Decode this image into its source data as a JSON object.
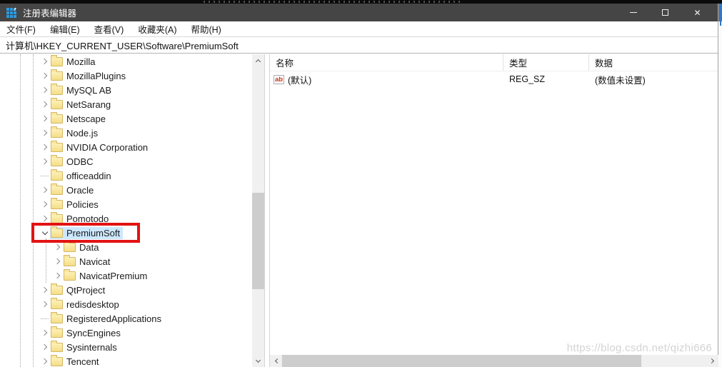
{
  "window": {
    "title": "注册表编辑器"
  },
  "icons": {
    "close": "✕",
    "app": "registry-grid-icon",
    "reg_sz_badge": "ab"
  },
  "menu": {
    "items": [
      "文件(F)",
      "编辑(E)",
      "查看(V)",
      "收藏夹(A)",
      "帮助(H)"
    ]
  },
  "address": {
    "value": "计算机\\HKEY_CURRENT_USER\\Software\\PremiumSoft"
  },
  "tree": {
    "items": [
      {
        "label": "Mozilla",
        "depth": 0,
        "chevron": "collapsed",
        "selected": false,
        "annotated": false
      },
      {
        "label": "MozillaPlugins",
        "depth": 0,
        "chevron": "collapsed",
        "selected": false,
        "annotated": false
      },
      {
        "label": "MySQL AB",
        "depth": 0,
        "chevron": "collapsed",
        "selected": false,
        "annotated": false
      },
      {
        "label": "NetSarang",
        "depth": 0,
        "chevron": "collapsed",
        "selected": false,
        "annotated": false
      },
      {
        "label": "Netscape",
        "depth": 0,
        "chevron": "collapsed",
        "selected": false,
        "annotated": false
      },
      {
        "label": "Node.js",
        "depth": 0,
        "chevron": "collapsed",
        "selected": false,
        "annotated": false
      },
      {
        "label": "NVIDIA Corporation",
        "depth": 0,
        "chevron": "collapsed",
        "selected": false,
        "annotated": false
      },
      {
        "label": "ODBC",
        "depth": 0,
        "chevron": "collapsed",
        "selected": false,
        "annotated": false
      },
      {
        "label": "officeaddin",
        "depth": 0,
        "chevron": "none",
        "selected": false,
        "annotated": false
      },
      {
        "label": "Oracle",
        "depth": 0,
        "chevron": "collapsed",
        "selected": false,
        "annotated": false
      },
      {
        "label": "Policies",
        "depth": 0,
        "chevron": "collapsed",
        "selected": false,
        "annotated": false
      },
      {
        "label": "Pomotodo",
        "depth": 0,
        "chevron": "collapsed",
        "selected": false,
        "annotated": false
      },
      {
        "label": "PremiumSoft",
        "depth": 0,
        "chevron": "expanded",
        "selected": true,
        "annotated": true
      },
      {
        "label": "Data",
        "depth": 1,
        "chevron": "collapsed",
        "selected": false,
        "annotated": false
      },
      {
        "label": "Navicat",
        "depth": 1,
        "chevron": "collapsed",
        "selected": false,
        "annotated": false
      },
      {
        "label": "NavicatPremium",
        "depth": 1,
        "chevron": "collapsed",
        "selected": false,
        "annotated": false
      },
      {
        "label": "QtProject",
        "depth": 0,
        "chevron": "collapsed",
        "selected": false,
        "annotated": false
      },
      {
        "label": "redisdesktop",
        "depth": 0,
        "chevron": "collapsed",
        "selected": false,
        "annotated": false
      },
      {
        "label": "RegisteredApplications",
        "depth": 0,
        "chevron": "none",
        "selected": false,
        "annotated": false
      },
      {
        "label": "SyncEngines",
        "depth": 0,
        "chevron": "collapsed",
        "selected": false,
        "annotated": false
      },
      {
        "label": "Sysinternals",
        "depth": 0,
        "chevron": "collapsed",
        "selected": false,
        "annotated": false
      },
      {
        "label": "Tencent",
        "depth": 0,
        "chevron": "collapsed",
        "selected": false,
        "annotated": false
      }
    ]
  },
  "list": {
    "columns": [
      "名称",
      "类型",
      "数据"
    ],
    "rows": [
      {
        "icon": "reg-sz-icon",
        "icon_text": "ab",
        "name": "(默认)",
        "type": "REG_SZ",
        "data": "(数值未设置)"
      }
    ]
  },
  "watermark": {
    "text": "https://blog.csdn.net/qizhi666"
  },
  "colors": {
    "titlebar": "#454545",
    "selection": "#cce8ff",
    "annotation_red": "#e21313",
    "folder_yellow": "#f4dd87",
    "accent_blue": "#2e77c8",
    "reg_sz_letters": "#cc3414"
  }
}
